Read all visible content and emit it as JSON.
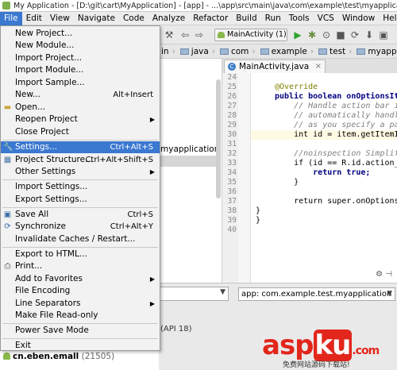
{
  "window": {
    "title": "My Application - [D:\\git\\cart\\MyApplication] - [app] - ...\\app\\src\\main\\java\\com\\example\\test\\myapplication"
  },
  "menubar": [
    "File",
    "Edit",
    "View",
    "Navigate",
    "Code",
    "Analyze",
    "Refactor",
    "Build",
    "Run",
    "Tools",
    "VCS",
    "Window",
    "Help"
  ],
  "toolbar": {
    "run_config": "MainActivity (1)"
  },
  "breadcrumb": [
    "in",
    "java",
    "com",
    "example",
    "test",
    "myapplication"
  ],
  "editor_tab": {
    "label": "MainActivity.java"
  },
  "project_pane": {
    "visible_text": "myapplication"
  },
  "file_menu": {
    "items": [
      {
        "label": "New Project...",
        "shortcut": ""
      },
      {
        "label": "New Module...",
        "shortcut": ""
      },
      {
        "label": "Import Project...",
        "shortcut": ""
      },
      {
        "label": "Import Module...",
        "shortcut": ""
      },
      {
        "label": "Import Sample...",
        "shortcut": ""
      },
      {
        "label": "New...",
        "shortcut": "Alt+Insert"
      },
      {
        "label": "Open...",
        "shortcut": ""
      },
      {
        "label": "Reopen Project",
        "shortcut": ""
      },
      {
        "label": "Close Project",
        "shortcut": ""
      },
      {
        "label": "Settings...",
        "shortcut": "Ctrl+Alt+S"
      },
      {
        "label": "Project Structure...",
        "shortcut": "Ctrl+Alt+Shift+S"
      },
      {
        "label": "Other Settings",
        "shortcut": ""
      },
      {
        "label": "Import Settings...",
        "shortcut": ""
      },
      {
        "label": "Export Settings...",
        "shortcut": ""
      },
      {
        "label": "Save All",
        "shortcut": "Ctrl+S"
      },
      {
        "label": "Synchronize",
        "shortcut": "Ctrl+Alt+Y"
      },
      {
        "label": "Invalidate Caches / Restart...",
        "shortcut": ""
      },
      {
        "label": "Export to HTML...",
        "shortcut": ""
      },
      {
        "label": "Print...",
        "shortcut": ""
      },
      {
        "label": "Add to Favorites",
        "shortcut": ""
      },
      {
        "label": "File Encoding",
        "shortcut": ""
      },
      {
        "label": "Line Separators",
        "shortcut": ""
      },
      {
        "label": "Make File Read-only",
        "shortcut": ""
      },
      {
        "label": "Power Save Mode",
        "shortcut": ""
      },
      {
        "label": "Exit",
        "shortcut": ""
      }
    ]
  },
  "code": {
    "line_numbers": [
      "24",
      "25",
      "26",
      "27",
      "28",
      "29",
      "30",
      "31",
      "32",
      "33",
      "34",
      "35",
      "36",
      "37",
      "38",
      "39",
      "40"
    ],
    "lines": [
      "",
      "@Override",
      "public boolean onOptionsIt",
      "    // Handle action bar i",
      "    // automatically handl",
      "    // as you specify a pa",
      "    int id = item.getItemI",
      "",
      "    //noinspection Simplif",
      "    if (id == R.id.action_",
      "        return true;",
      "    }",
      "",
      "    return super.onOptions",
      "}",
      "}",
      ""
    ]
  },
  "lower_panel": {
    "app_selector": "app: com.example.test.myapplication",
    "api_text": "(API 18)",
    "process_name": "cn.eben.emall",
    "process_pid": "(21505)"
  },
  "watermark": {
    "brand": "asp",
    "brand_highlight": "ku",
    "tld": ".com",
    "subtitle": "免费网站源码下载站!"
  }
}
